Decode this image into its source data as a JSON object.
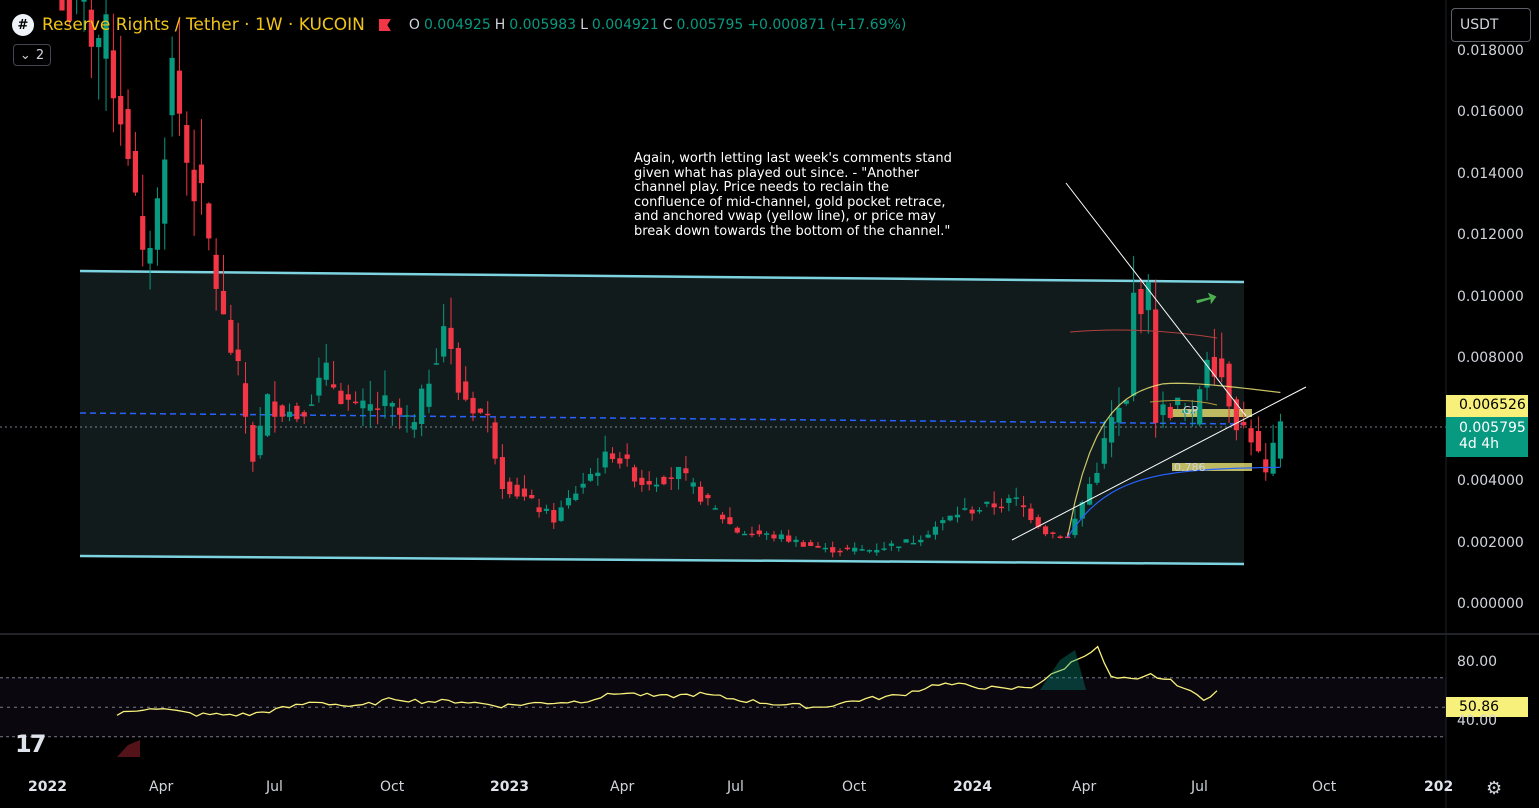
{
  "header": {
    "logo": "#",
    "symbol": "Reserve Rights / Tether · 1W · KUCOIN",
    "open_label": "O",
    "open": "0.004925",
    "high_label": "H",
    "high": "0.005983",
    "low_label": "L",
    "low": "0.004921",
    "close_label": "C",
    "close": "0.005795",
    "change": "+0.000871 (+17.69%)",
    "collapse_count": "2"
  },
  "currency": "USDT",
  "annotation": "Again, worth letting last week's comments stand given what has played out since. - \"Another channel play. Price needs to reclain the confluence of mid-channel, gold pocket retrace, and anchored vwap (yellow line), or price may break down towards the bottom of the channel.\"",
  "price_tags": {
    "level": "0.006526",
    "last_price": "0.005795",
    "countdown": "4d 4h",
    "rsi_value": "50.86"
  },
  "fib_labels": {
    "gp": "GP",
    "fib_786": "0.786"
  },
  "colors": {
    "up": "#089981",
    "down": "#f23645",
    "channel": "#7dd3e0",
    "mid_channel": "#2962ff",
    "vwap": "#f7f07a",
    "rsi": "#f7f07a",
    "arrow": "#4caf50"
  },
  "icons": {
    "settings": "gear-icon",
    "tradingview": "tradingview-logo",
    "arrow": "up-arrow-icon"
  },
  "chart_data": {
    "type": "candlestick",
    "title": "Reserve Rights / Tether · 1W · KUCOIN",
    "price_axis": {
      "ticks": [
        "0.018000",
        "0.016000",
        "0.014000",
        "0.012000",
        "0.010000",
        "0.008000",
        "0.004000",
        "0.002000",
        "0.000000"
      ],
      "ylim": [
        -0.0002,
        0.0188
      ]
    },
    "time_axis": {
      "ticks": [
        "2022",
        "Apr",
        "Jul",
        "Oct",
        "2023",
        "Apr",
        "Jul",
        "Oct",
        "2024",
        "Apr",
        "Jul",
        "Oct",
        "202"
      ]
    },
    "rsi": {
      "ticks": [
        "80.00",
        "40.00"
      ],
      "levels": [
        70,
        50,
        30
      ],
      "last": 50.86
    },
    "anchors": [
      {
        "x": 0,
        "c": 0.0199
      },
      {
        "x": 6,
        "c": 0.0182
      },
      {
        "x": 9,
        "c": 0.015
      },
      {
        "x": 11,
        "c": 0.011
      },
      {
        "x": 13,
        "c": 0.013
      },
      {
        "x": 15,
        "c": 0.0175
      },
      {
        "x": 17,
        "c": 0.0145
      },
      {
        "x": 19,
        "c": 0.013
      },
      {
        "x": 22,
        "c": 0.0092
      },
      {
        "x": 24,
        "c": 0.0075
      },
      {
        "x": 26,
        "c": 0.0048
      },
      {
        "x": 28,
        "c": 0.0066
      },
      {
        "x": 32,
        "c": 0.0062
      },
      {
        "x": 36,
        "c": 0.0075
      },
      {
        "x": 40,
        "c": 0.0063
      },
      {
        "x": 44,
        "c": 0.0065
      },
      {
        "x": 48,
        "c": 0.0058
      },
      {
        "x": 52,
        "c": 0.0092
      },
      {
        "x": 54,
        "c": 0.007
      },
      {
        "x": 58,
        "c": 0.006
      },
      {
        "x": 60,
        "c": 0.004
      },
      {
        "x": 64,
        "c": 0.0033
      },
      {
        "x": 67,
        "c": 0.0028
      },
      {
        "x": 71,
        "c": 0.004
      },
      {
        "x": 75,
        "c": 0.005
      },
      {
        "x": 79,
        "c": 0.004
      },
      {
        "x": 84,
        "c": 0.0043
      },
      {
        "x": 88,
        "c": 0.0033
      },
      {
        "x": 92,
        "c": 0.0024
      },
      {
        "x": 98,
        "c": 0.0022
      },
      {
        "x": 104,
        "c": 0.0018
      },
      {
        "x": 110,
        "c": 0.0018
      },
      {
        "x": 116,
        "c": 0.0021
      },
      {
        "x": 122,
        "c": 0.003
      },
      {
        "x": 126,
        "c": 0.0032
      },
      {
        "x": 130,
        "c": 0.0034
      },
      {
        "x": 134,
        "c": 0.0024
      },
      {
        "x": 137,
        "c": 0.0022
      },
      {
        "x": 141,
        "c": 0.0045
      },
      {
        "x": 143,
        "c": 0.006
      },
      {
        "x": 145,
        "c": 0.0065
      },
      {
        "x": 146,
        "c": 0.01
      },
      {
        "x": 148,
        "c": 0.01
      },
      {
        "x": 149,
        "c": 0.0062
      },
      {
        "x": 152,
        "c": 0.0065
      },
      {
        "x": 154,
        "c": 0.006
      },
      {
        "x": 156,
        "c": 0.0083
      },
      {
        "x": 158,
        "c": 0.0075
      },
      {
        "x": 160,
        "c": 0.006
      },
      {
        "x": 162,
        "c": 0.0055
      },
      {
        "x": 164,
        "c": 0.0042
      },
      {
        "x": 166,
        "c": 0.0058
      }
    ],
    "rsi_anchors": [
      {
        "x": 0,
        "v": 45
      },
      {
        "x": 5,
        "v": 50
      },
      {
        "x": 12,
        "v": 45
      },
      {
        "x": 20,
        "v": 45
      },
      {
        "x": 26,
        "v": 50
      },
      {
        "x": 30,
        "v": 54
      },
      {
        "x": 36,
        "v": 50
      },
      {
        "x": 42,
        "v": 56
      },
      {
        "x": 46,
        "v": 54
      },
      {
        "x": 52,
        "v": 54
      },
      {
        "x": 58,
        "v": 51
      },
      {
        "x": 64,
        "v": 53
      },
      {
        "x": 70,
        "v": 54
      },
      {
        "x": 76,
        "v": 60
      },
      {
        "x": 82,
        "v": 57
      },
      {
        "x": 88,
        "v": 59
      },
      {
        "x": 94,
        "v": 55
      },
      {
        "x": 100,
        "v": 52
      },
      {
        "x": 106,
        "v": 50
      },
      {
        "x": 112,
        "v": 55
      },
      {
        "x": 118,
        "v": 58
      },
      {
        "x": 124,
        "v": 66
      },
      {
        "x": 130,
        "v": 64
      },
      {
        "x": 134,
        "v": 62
      },
      {
        "x": 138,
        "v": 64
      },
      {
        "x": 142,
        "v": 74
      },
      {
        "x": 146,
        "v": 86
      },
      {
        "x": 148,
        "v": 90
      },
      {
        "x": 150,
        "v": 70
      },
      {
        "x": 154,
        "v": 68
      },
      {
        "x": 156,
        "v": 72
      },
      {
        "x": 160,
        "v": 66
      },
      {
        "x": 162,
        "v": 60
      },
      {
        "x": 164,
        "v": 56
      },
      {
        "x": 166,
        "v": 61
      }
    ]
  }
}
